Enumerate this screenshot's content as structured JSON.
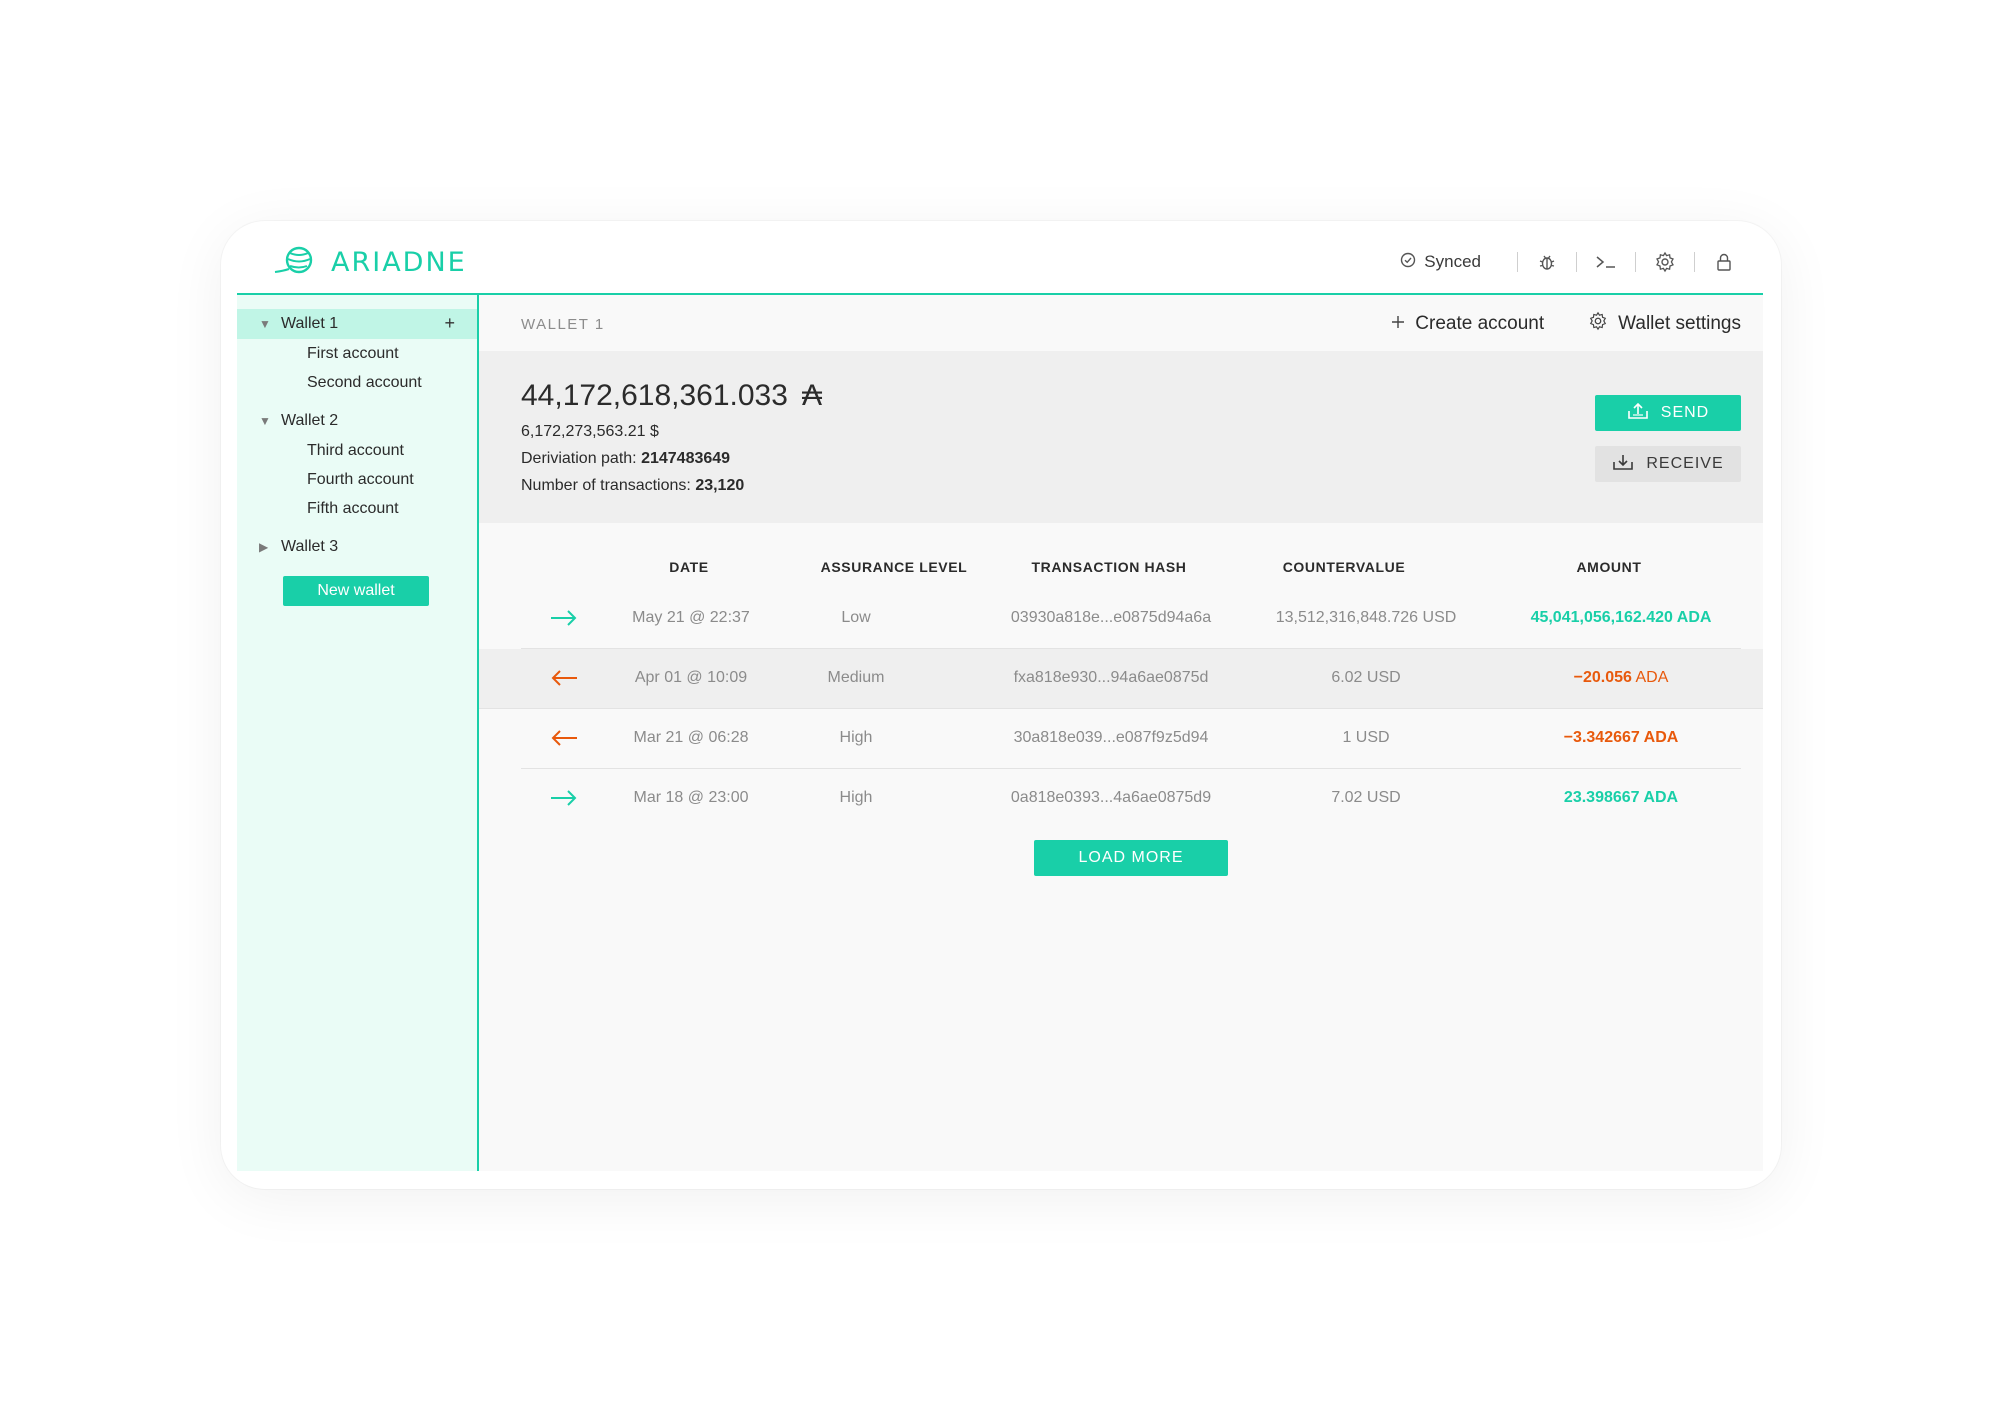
{
  "header": {
    "brand": "ARIADNE",
    "sync_status": "Synced"
  },
  "sidebar": {
    "wallets": [
      {
        "name": "Wallet 1",
        "accounts": [
          "First account",
          "Second account"
        ]
      },
      {
        "name": "Wallet 2",
        "accounts": [
          "Third account",
          "Fourth account",
          "Fifth account"
        ]
      },
      {
        "name": "Wallet 3",
        "accounts": []
      }
    ],
    "add_icon": "+",
    "new_wallet_label": "New wallet"
  },
  "main": {
    "breadcrumb": "WALLET 1",
    "create_account_label": "Create account",
    "wallet_settings_label": "Wallet settings",
    "balance": "44,172,618,361.033",
    "currency_symbol": "₳",
    "usd_balance": "6,172,273,563.21 $",
    "derivation_label": "Deriviation path:",
    "derivation_value": "2147483649",
    "tx_count_label": "Number of transactions:",
    "tx_count_value": "23,120",
    "send_label": "SEND",
    "receive_label": "RECEIVE"
  },
  "table": {
    "columns": [
      "DATE",
      "ASSURANCE LEVEL",
      "TRANSACTION HASH",
      "COUNTERVALUE",
      "AMOUNT"
    ],
    "rows": [
      {
        "direction": "incoming",
        "date": "May 21 @ 22:37",
        "assurance": "Low",
        "hash": "03930a818e...e0875d94a6a",
        "countervalue": "13,512,316,848.726 USD",
        "amount": "45,041,056,162.420 ADA",
        "unit": ""
      },
      {
        "direction": "outgoing",
        "date": "Apr 01 @ 10:09",
        "assurance": "Medium",
        "hash": "fxa818e930...94a6ae0875d",
        "countervalue": "6.02 USD",
        "amount": "−20.056",
        "unit": " ADA"
      },
      {
        "direction": "outgoing",
        "date": "Mar 21 @ 06:28",
        "assurance": "High",
        "hash": "30a818e039...e087f9z5d94",
        "countervalue": "1 USD",
        "amount": "−3.342667",
        "unit": " ADA"
      },
      {
        "direction": "incoming",
        "date": "Mar 18 @ 23:00",
        "assurance": "High",
        "hash": "0a818e0393...4a6ae0875d9",
        "countervalue": "7.02 USD",
        "amount": "23.398667 ADA",
        "unit": ""
      }
    ],
    "load_more_label": "LOAD MORE"
  },
  "colors": {
    "accent": "#19cfa8",
    "incoming": "#19cfa8",
    "outgoing": "#e8590c",
    "sidebar_bg": "#eafcf6",
    "sidebar_active": "#c0f5e6"
  },
  "icons": {
    "logo": "yarn-ball-icon",
    "synced": "check-circle-icon",
    "debug": "bug-icon",
    "terminal": "terminal-icon",
    "settings": "gear-icon",
    "lock": "lock-icon"
  }
}
